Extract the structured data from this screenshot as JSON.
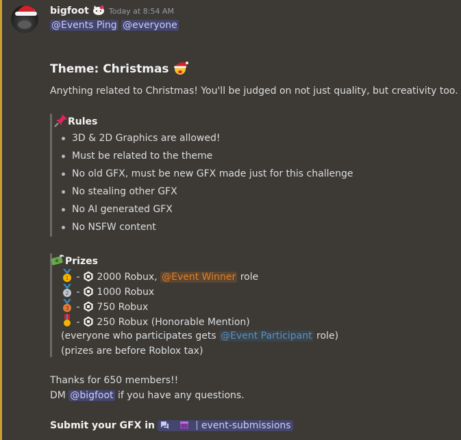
{
  "header": {
    "username": "bigfoot",
    "badge_icon": "hello-kitty-icon",
    "timestamp": "Today at 8:54 AM"
  },
  "mentions": {
    "roles": [
      "@Events Ping",
      "@everyone"
    ]
  },
  "theme": {
    "title": "Theme: Christmas",
    "description": "Anything related to Christmas! You'll be judged on not just quality, but creativity too."
  },
  "rules": {
    "heading": "Rules",
    "items": [
      "3D & 2D Graphics are allowed!",
      "Must be related to the theme",
      "No old GFX, must be new GFX made just for this challenge",
      "No stealing other GFX",
      "No AI generated GFX",
      "No NSFW content"
    ]
  },
  "prizes": {
    "heading": "Prizes",
    "dash": "-",
    "p1_amount": "2000 Robux,",
    "p1_role": "@Event Winner",
    "p1_suffix": "role",
    "p2_amount": "1000 Robux",
    "p3_amount": "750 Robux",
    "p4_amount": "250 Robux (Honorable Mention)",
    "note1_prefix": "(everyone who participates gets",
    "note1_role": "@Event Participant",
    "note1_suffix": "role)",
    "note2": "(prizes are before Roblox tax)"
  },
  "footer": {
    "thanks": "Thanks for 650 members!!",
    "dm_prefix": "DM",
    "dm_user": "@bigfoot",
    "dm_suffix": "if you have any questions.",
    "submit_text": "Submit your GFX in",
    "channel_name": "event-submissions"
  },
  "colors": {
    "accent_bar": "#c9a233",
    "background": "#3d3a35",
    "mention_orange": "#e67e22"
  }
}
